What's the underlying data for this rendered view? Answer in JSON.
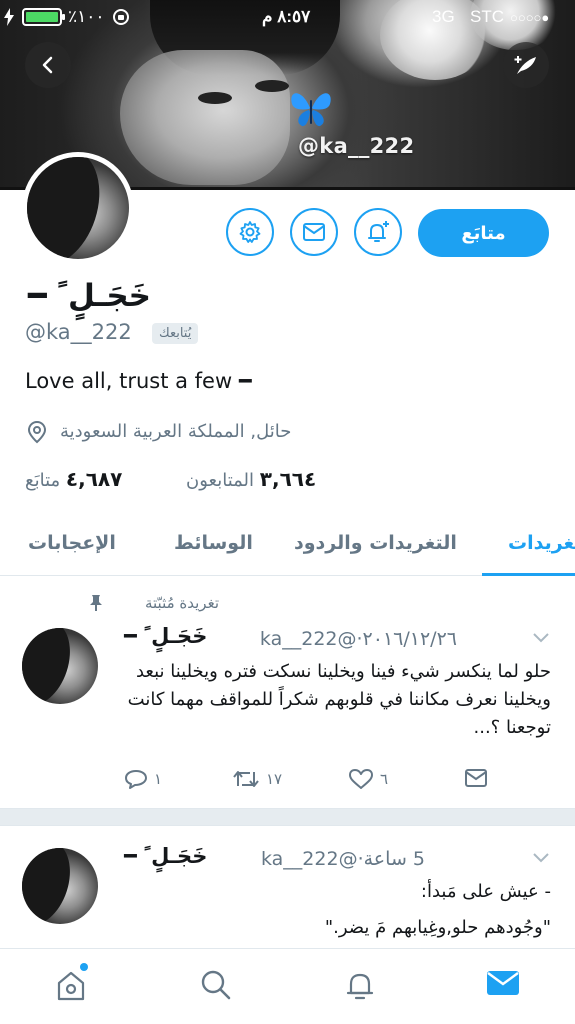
{
  "status_bar": {
    "battery_percent": "٪١٠٠",
    "time": "٨:٥٧ م",
    "network": "3G",
    "carrier": "STC",
    "signal": "○○○○●"
  },
  "banner": {
    "handle": "@ka__222"
  },
  "profile": {
    "display_name": "خَجَـلٍ ً ━",
    "handle": "@ka__222",
    "follows_you": "يُتابعك",
    "bio": "Love all, trust a few ━",
    "location": "حائل, المملكة العربية السعودية",
    "followers_count": "٣,٦٦٤",
    "followers_label": "المتابعون",
    "following_count": "٤,٦٨٧",
    "following_label": "متابَع",
    "follow_button": "متابَع"
  },
  "tabs": {
    "tweets": "تغريدات",
    "tweets_replies": "التغريدات والردود",
    "media": "الوسائط",
    "likes": "الإعجابات"
  },
  "tweets": [
    {
      "pinned_label": "تغريدة مُثبّتة",
      "name": "خَجَـلٍ ً ━",
      "handle": "@ka__222",
      "date": "٢٠١٦/١٢/٢٦",
      "text": "حلو لما ينكسر شيء فينا ويخلينا نسكت فتره ويخلينا نبعد ويخلينا نعرف مكاننا في قلوبهم شكراً للمواقف مهما كانت توجعنا ؟...",
      "replies": "١",
      "retweets": "١٧",
      "likes": "٦"
    },
    {
      "name": "خَجَـلٍ ً ━",
      "handle": "@ka__222",
      "date": "5 ساعة",
      "line1": "- عيش على مَبدأ:",
      "line2": "\"وجُودهم حلو,وغِيابهم مَ يضر.\""
    }
  ]
}
